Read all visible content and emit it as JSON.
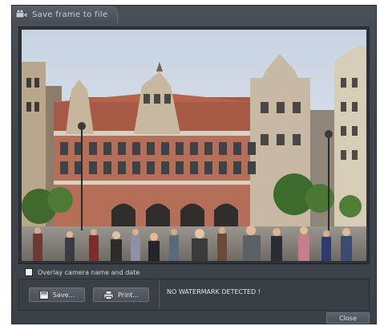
{
  "window": {
    "title": "Save frame to file"
  },
  "options": {
    "overlay_label": "Overlay camera name and date",
    "overlay_checked": false
  },
  "actions": {
    "save_label": "Save...",
    "print_label": "Print..."
  },
  "status": {
    "message": "NO WATERMARK DETECTED !"
  },
  "footer": {
    "close_label": "Close"
  },
  "icons": {
    "title": "camera-icon",
    "save": "disk-icon",
    "print": "printer-icon"
  },
  "colors": {
    "window_bg": "#3f454c",
    "text": "#d6d9dc"
  }
}
